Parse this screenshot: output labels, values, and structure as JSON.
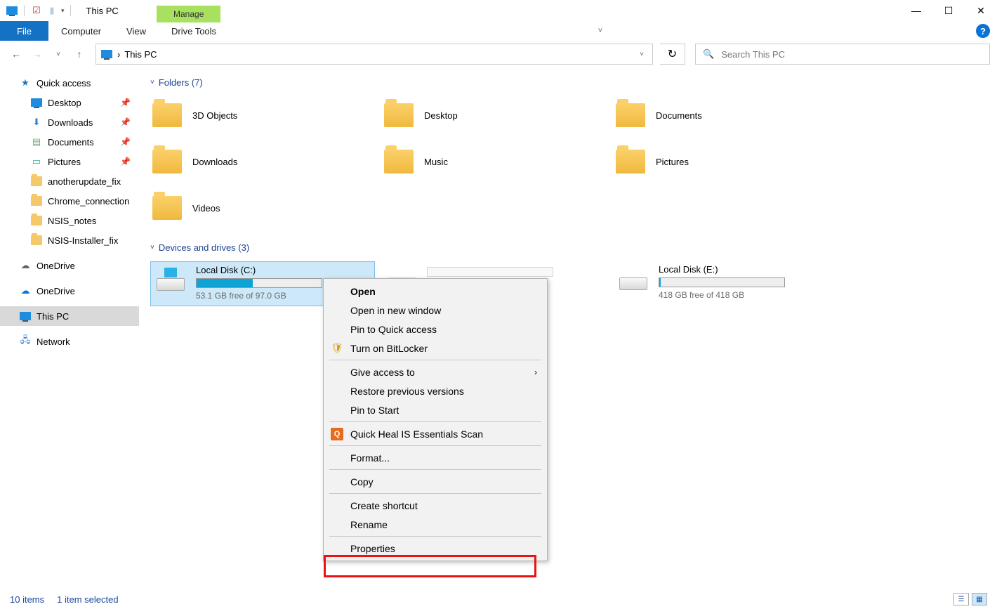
{
  "titlebar": {
    "title": "This PC",
    "manage_tab": "Manage"
  },
  "window_controls": {
    "min": "—",
    "max": "☐",
    "close": "✕"
  },
  "menu": {
    "file": "File",
    "computer": "Computer",
    "view": "View",
    "drive_tools": "Drive Tools"
  },
  "nav": {
    "back": "←",
    "forward": "→",
    "up": "↑",
    "refresh": "↻"
  },
  "address": {
    "chevron": "›",
    "location": "This PC",
    "dropdown": "˅"
  },
  "search": {
    "placeholder": "Search This PC",
    "icon": "🔍"
  },
  "sidebar": {
    "quick_access": "Quick access",
    "items": [
      {
        "label": "Desktop",
        "pinned": true
      },
      {
        "label": "Downloads",
        "pinned": true
      },
      {
        "label": "Documents",
        "pinned": true
      },
      {
        "label": "Pictures",
        "pinned": true
      },
      {
        "label": "anotherupdate_fix",
        "pinned": false
      },
      {
        "label": "Chrome_connection",
        "pinned": false
      },
      {
        "label": "NSIS_notes",
        "pinned": false
      },
      {
        "label": "NSIS-Installer_fix",
        "pinned": false
      }
    ],
    "onedrive1": "OneDrive",
    "onedrive2": "OneDrive",
    "this_pc": "This PC",
    "network": "Network"
  },
  "groups": {
    "folders_label": "Folders (7)",
    "devices_label": "Devices and drives (3)"
  },
  "folders": [
    {
      "name": "3D Objects"
    },
    {
      "name": "Desktop"
    },
    {
      "name": "Documents"
    },
    {
      "name": "Downloads"
    },
    {
      "name": "Music"
    },
    {
      "name": "Pictures"
    },
    {
      "name": "Videos"
    }
  ],
  "drives": [
    {
      "name": "Local Disk (C:)",
      "free_text": "53.1 GB free of 97.0 GB",
      "fill_pct": 45,
      "selected": true,
      "win": true
    },
    {
      "name": "",
      "free_text": "",
      "fill_pct": 0,
      "selected": false,
      "placeholder": true
    },
    {
      "name": "Local Disk (E:)",
      "free_text": "418 GB free of 418 GB",
      "fill_pct": 1,
      "selected": false
    }
  ],
  "context_menu": {
    "open": "Open",
    "open_new": "Open in new window",
    "pin_qa": "Pin to Quick access",
    "bitlocker": "Turn on BitLocker",
    "give_access": "Give access to",
    "restore": "Restore previous versions",
    "pin_start": "Pin to Start",
    "quickheal": "Quick Heal IS Essentials Scan",
    "format": "Format...",
    "copy": "Copy",
    "shortcut": "Create shortcut",
    "rename": "Rename",
    "properties": "Properties"
  },
  "status": {
    "items": "10 items",
    "selected": "1 item selected"
  }
}
